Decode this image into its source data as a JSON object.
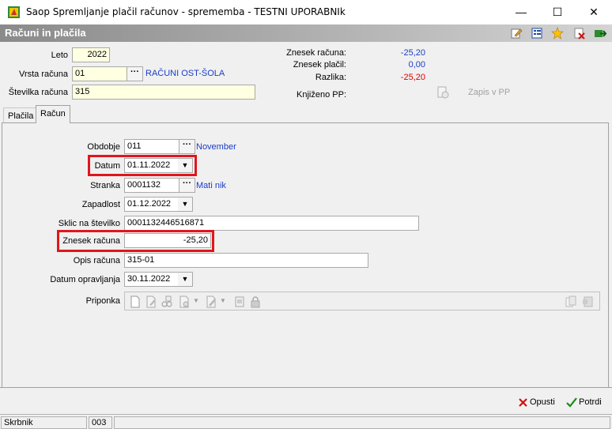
{
  "window": {
    "title": "Saop Spremljanje plačil računov - sprememba - TESTNI UPORABNIk",
    "minimize_glyph": "—",
    "maximize_glyph": "☐",
    "close_glyph": "✕"
  },
  "header": {
    "title": "Računi in plačila",
    "icons": [
      "edit-icon",
      "properties-icon",
      "star-icon",
      "delete-icon",
      "exit-icon"
    ]
  },
  "top": {
    "leto_label": "Leto",
    "leto_value": "2022",
    "vrsta_label": "Vrsta računa",
    "vrsta_value": "01",
    "vrsta_name": "RAČUNI OST-ŠOLA",
    "stevilka_label": "Številka računa",
    "stevilka_value": "315",
    "znesek_racuna_label": "Znesek računa:",
    "znesek_racuna_value": "-25,20",
    "znesek_placil_label": "Znesek plačil:",
    "znesek_placil_value": "0,00",
    "razlika_label": "Razlika:",
    "razlika_value": "-25,20",
    "knjizeno_label": "Knjiženo PP:",
    "zapis_label": "Zapis v PP",
    "dots": "···"
  },
  "tabs": [
    {
      "label": "Plačila"
    },
    {
      "label": "Račun"
    }
  ],
  "form": {
    "obdobje_label": "Obdobje",
    "obdobje_value": "011",
    "obdobje_name": "November",
    "datum_label": "Datum",
    "datum_value": "01.11.2022",
    "stranka_label": "Stranka",
    "stranka_value": "0001132",
    "stranka_name": "Mati nik",
    "zapadlost_label": "Zapadlost",
    "zapadlost_value": "01.12.2022",
    "sklic_label": "Sklic na številko",
    "sklic_value": "0001132446516871",
    "znesek_label": "Znesek računa",
    "znesek_value": "-25,20",
    "opis_label": "Opis računa",
    "opis_value": "315-01",
    "datum_opr_label": "Datum opravljanja",
    "datum_opr_value": "30.11.2022",
    "priponka_label": "Priponka",
    "dropdown_glyph": "▼"
  },
  "footer": {
    "opusti_label": "Opusti",
    "potrdi_label": "Potrdi"
  },
  "status": {
    "user": "Skrbnik",
    "code": "003"
  },
  "colors": {
    "highlight": "#e0161c",
    "link_blue": "#1a3cc8",
    "negative_red": "#e00000",
    "input_yellow": "#ffffe1"
  }
}
